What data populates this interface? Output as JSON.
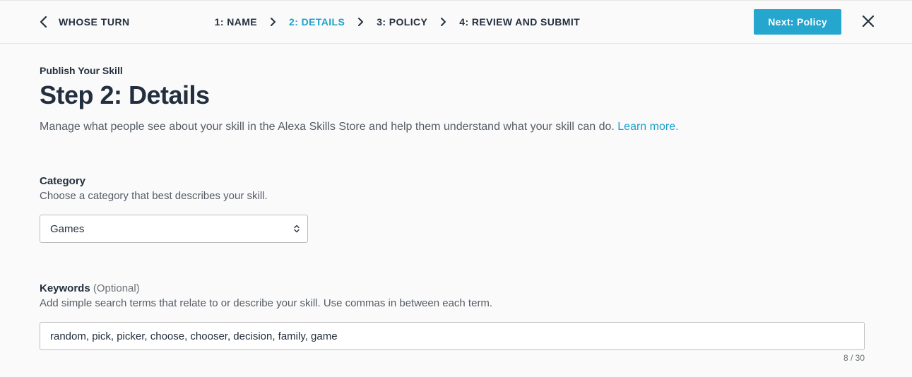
{
  "topbar": {
    "back_label": "WHOSE TURN",
    "crumbs": [
      {
        "label": "1: NAME"
      },
      {
        "label": "2: DETAILS"
      },
      {
        "label": "3: POLICY"
      },
      {
        "label": "4: REVIEW AND SUBMIT"
      }
    ],
    "next_label": "Next: Policy"
  },
  "page": {
    "kicker": "Publish Your Skill",
    "title": "Step 2: Details",
    "lead_text": "Manage what people see about your skill in the Alexa Skills Store and help them understand what your skill can do. ",
    "lead_link": "Learn more."
  },
  "category": {
    "label": "Category",
    "help": "Choose a category that best describes your skill.",
    "value": "Games"
  },
  "keywords": {
    "label": "Keywords",
    "optional": " (Optional)",
    "help": "Add simple search terms that relate to or describe your skill. Use commas in between each term.",
    "value": "random, pick, picker, choose, chooser, decision, family, game",
    "counter": "8 / 30"
  }
}
